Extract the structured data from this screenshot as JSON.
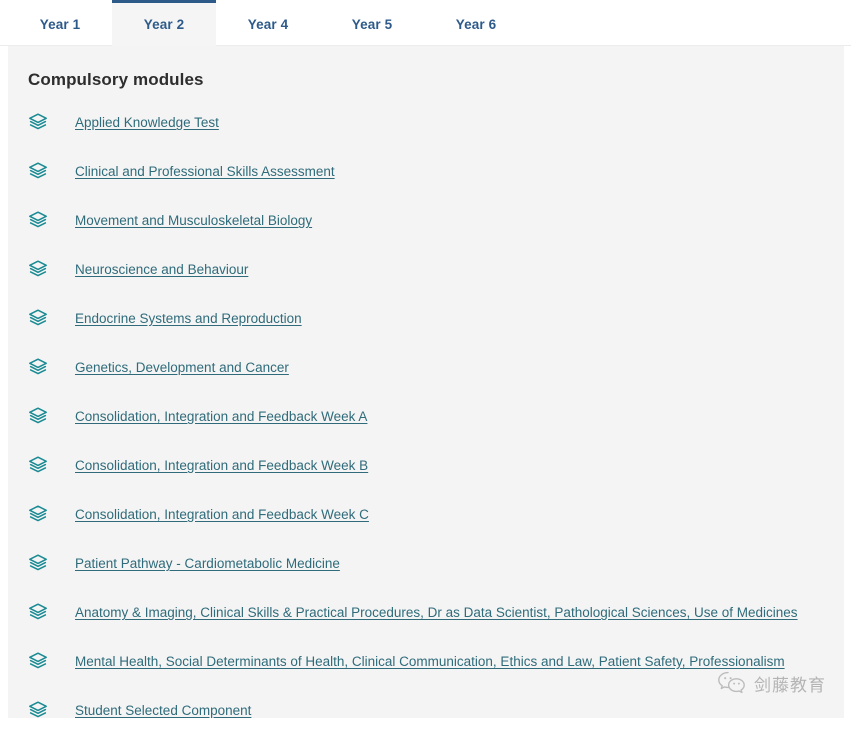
{
  "tabs": [
    {
      "label": "Year 1",
      "active": false
    },
    {
      "label": "Year 2",
      "active": true
    },
    {
      "label": "Year 4",
      "active": false
    },
    {
      "label": "Year 5",
      "active": false
    },
    {
      "label": "Year 6",
      "active": false
    }
  ],
  "panel": {
    "title": "Compulsory modules",
    "item_icon": "layers-icon",
    "modules": [
      {
        "label": "Applied Knowledge Test"
      },
      {
        "label": "Clinical and Professional Skills Assessment"
      },
      {
        "label": "Movement and Musculoskeletal Biology"
      },
      {
        "label": "Neuroscience and Behaviour"
      },
      {
        "label": "Endocrine Systems and Reproduction"
      },
      {
        "label": "Genetics, Development and Cancer"
      },
      {
        "label": "Consolidation, Integration and Feedback Week A"
      },
      {
        "label": "Consolidation, Integration and Feedback Week B"
      },
      {
        "label": "Consolidation, Integration and Feedback Week C"
      },
      {
        "label": "Patient Pathway - Cardiometabolic Medicine"
      },
      {
        "label": "Anatomy & Imaging, Clinical Skills & Practical Procedures, Dr as Data Scientist, Pathological Sciences, Use of Medicines"
      },
      {
        "label": "Mental Health, Social Determinants of Health, Clinical Communication, Ethics and Law, Patient Safety, Professionalism"
      },
      {
        "label": "Student Selected Component"
      }
    ]
  },
  "watermark": {
    "text": "剑藤教育",
    "icon": "wechat-icon"
  },
  "colors": {
    "tab_text": "#2e5a8a",
    "tab_active_border": "#2e5a8a",
    "tab_active_background": "#f5f5f5",
    "panel_background": "#f4f4f4",
    "heading_text": "#2d2d2d",
    "link_text": "#2f6b7a",
    "icon_teal": "#1a8a93",
    "page_background": "#ffffff"
  }
}
